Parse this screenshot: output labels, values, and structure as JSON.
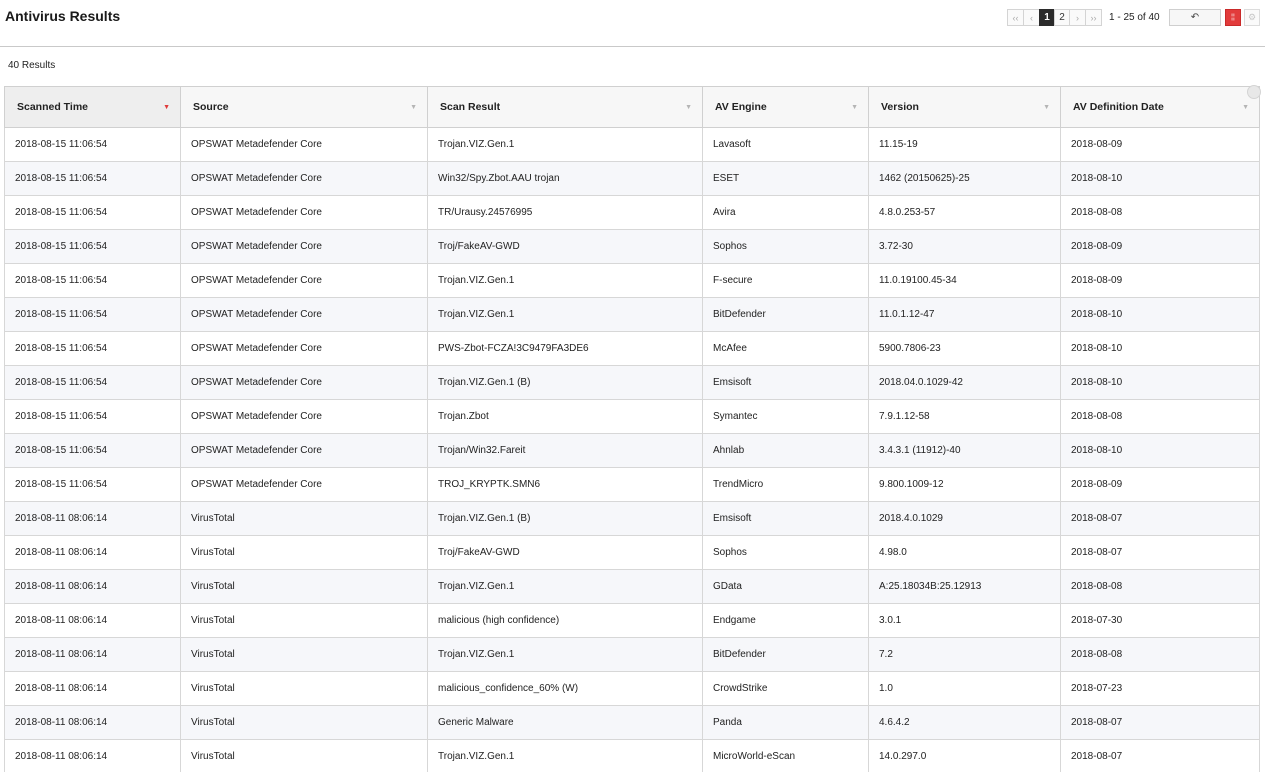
{
  "header": {
    "title": "Antivirus Results",
    "pager": {
      "first": "‹‹",
      "prev": "‹",
      "pages": [
        "1",
        "2"
      ],
      "next": "›",
      "last": "››",
      "range": "1 - 25 of 40"
    },
    "undo_icon": "↶",
    "red_icon": "¦¦",
    "gear_icon": "⚙"
  },
  "results_count": "40 Results",
  "table": {
    "columns": [
      "Scanned Time",
      "Source",
      "Scan Result",
      "AV Engine",
      "Version",
      "AV Definition Date"
    ],
    "sort_indicator": "▼",
    "rows": [
      [
        "2018-08-15 11:06:54",
        "OPSWAT Metadefender Core",
        "Trojan.VIZ.Gen.1",
        "Lavasoft",
        "11.15-19",
        "2018-08-09"
      ],
      [
        "2018-08-15 11:06:54",
        "OPSWAT Metadefender Core",
        "Win32/Spy.Zbot.AAU trojan",
        "ESET",
        "1462 (20150625)-25",
        "2018-08-10"
      ],
      [
        "2018-08-15 11:06:54",
        "OPSWAT Metadefender Core",
        "TR/Urausy.24576995",
        "Avira",
        "4.8.0.253-57",
        "2018-08-08"
      ],
      [
        "2018-08-15 11:06:54",
        "OPSWAT Metadefender Core",
        "Troj/FakeAV-GWD",
        "Sophos",
        "3.72-30",
        "2018-08-09"
      ],
      [
        "2018-08-15 11:06:54",
        "OPSWAT Metadefender Core",
        "Trojan.VIZ.Gen.1",
        "F-secure",
        "11.0.19100.45-34",
        "2018-08-09"
      ],
      [
        "2018-08-15 11:06:54",
        "OPSWAT Metadefender Core",
        "Trojan.VIZ.Gen.1",
        "BitDefender",
        "11.0.1.12-47",
        "2018-08-10"
      ],
      [
        "2018-08-15 11:06:54",
        "OPSWAT Metadefender Core",
        "PWS-Zbot-FCZA!3C9479FA3DE6",
        "McAfee",
        "5900.7806-23",
        "2018-08-10"
      ],
      [
        "2018-08-15 11:06:54",
        "OPSWAT Metadefender Core",
        "Trojan.VIZ.Gen.1 (B)",
        "Emsisoft",
        "2018.04.0.1029-42",
        "2018-08-10"
      ],
      [
        "2018-08-15 11:06:54",
        "OPSWAT Metadefender Core",
        "Trojan.Zbot",
        "Symantec",
        "7.9.1.12-58",
        "2018-08-08"
      ],
      [
        "2018-08-15 11:06:54",
        "OPSWAT Metadefender Core",
        "Trojan/Win32.Fareit",
        "Ahnlab",
        "3.4.3.1 (11912)-40",
        "2018-08-10"
      ],
      [
        "2018-08-15 11:06:54",
        "OPSWAT Metadefender Core",
        "TROJ_KRYPTK.SMN6",
        "TrendMicro",
        "9.800.1009-12",
        "2018-08-09"
      ],
      [
        "2018-08-11 08:06:14",
        "VirusTotal",
        "Trojan.VIZ.Gen.1 (B)",
        "Emsisoft",
        "2018.4.0.1029",
        "2018-08-07"
      ],
      [
        "2018-08-11 08:06:14",
        "VirusTotal",
        "Troj/FakeAV-GWD",
        "Sophos",
        "4.98.0",
        "2018-08-07"
      ],
      [
        "2018-08-11 08:06:14",
        "VirusTotal",
        "Trojan.VIZ.Gen.1",
        "GData",
        "A:25.18034B:25.12913",
        "2018-08-08"
      ],
      [
        "2018-08-11 08:06:14",
        "VirusTotal",
        "malicious (high confidence)",
        "Endgame",
        "3.0.1",
        "2018-07-30"
      ],
      [
        "2018-08-11 08:06:14",
        "VirusTotal",
        "Trojan.VIZ.Gen.1",
        "BitDefender",
        "7.2",
        "2018-08-08"
      ],
      [
        "2018-08-11 08:06:14",
        "VirusTotal",
        "malicious_confidence_60% (W)",
        "CrowdStrike",
        "1.0",
        "2018-07-23"
      ],
      [
        "2018-08-11 08:06:14",
        "VirusTotal",
        "Generic Malware",
        "Panda",
        "4.6.4.2",
        "2018-08-07"
      ],
      [
        "2018-08-11 08:06:14",
        "VirusTotal",
        "Trojan.VIZ.Gen.1",
        "MicroWorld-eScan",
        "14.0.297.0",
        "2018-08-07"
      ]
    ]
  },
  "colors": {
    "accent_red": "#e23b3b",
    "active_page": "#2b2b2b",
    "row_alt": "#f6f7fa"
  }
}
